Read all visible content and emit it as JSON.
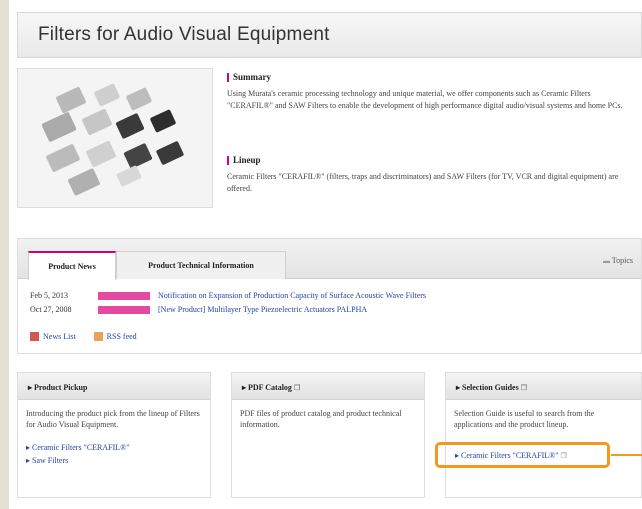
{
  "title": "Filters for Audio Visual Equipment",
  "summary": {
    "heading": "Summary",
    "text": "Using Murata's ceramic processing technology and unique material, we offer components such as Ceramic Filters \"CERAFIL®\" and SAW Filters to enable the development of high performance digital audio/visual systems and home PCs."
  },
  "lineup": {
    "heading": "Lineup",
    "text": "Ceramic Filters \"CERAFIL®\" (filters, traps and discriminators) and SAW Filters (for TV, VCR and digital equipment) are offered."
  },
  "tabs": {
    "news": "Product News",
    "tech": "Product Technical Information",
    "topics": "Topics"
  },
  "news": [
    {
      "date": "Feb 5, 2013",
      "text": "Notification on Expansion of Production Capacity of Surface Acoustic Wave Filters"
    },
    {
      "date": "Oct 27, 2008",
      "text": "[New Product] Multilayer Type Piezoelectric Actuators PALPHA"
    }
  ],
  "legend": {
    "news_list": "News List",
    "rss": "RSS feed"
  },
  "pickup": {
    "heading": "Product Pickup",
    "text": "Introducing the product pick from the lineup of Filters for Audio Visual Equipment.",
    "links": [
      "Ceramic Filters \"CERAFIL®\"",
      "Saw Filters"
    ]
  },
  "pdf": {
    "heading": "PDF Catalog",
    "text": "PDF files of product catalog and product technical information."
  },
  "guides": {
    "heading": "Selection Guides",
    "text": "Selection Guide is useful to search from the applications and the product lineup.",
    "link": "Ceramic Filters \"CERAFIL®\""
  },
  "colors": {
    "accent": "#d4006b",
    "badge": "#e44aa0",
    "highlight": "#f29a1d",
    "link": "#2345a8"
  }
}
